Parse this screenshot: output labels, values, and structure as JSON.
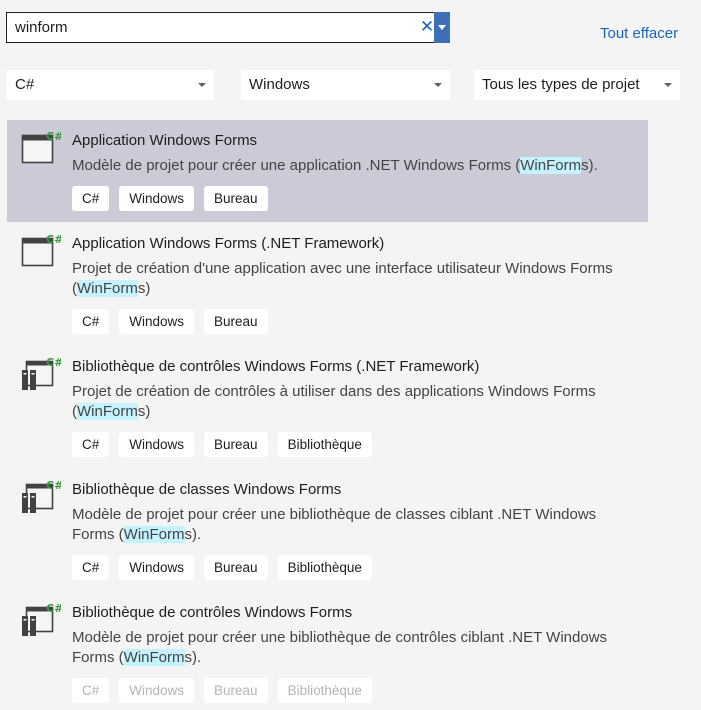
{
  "search": {
    "value": "winform",
    "clear_label": "Tout effacer"
  },
  "filters": {
    "language": "C#",
    "platform": "Windows",
    "project_type": "Tous les types de projet"
  },
  "results": [
    {
      "title": "Application Windows Forms",
      "desc_before": "Modèle de projet pour créer une application .NET Windows Forms (",
      "desc_highlight": "WinForm",
      "desc_after": "s).",
      "tags": [
        "C#",
        "Windows",
        "Bureau"
      ]
    },
    {
      "title": "Application Windows Forms (.NET Framework)",
      "desc_before": "Projet de création d'une application avec une interface utilisateur Windows Forms (",
      "desc_highlight": "WinForm",
      "desc_after": "s)",
      "tags": [
        "C#",
        "Windows",
        "Bureau"
      ]
    },
    {
      "title": "Bibliothèque de contrôles Windows Forms (.NET Framework)",
      "desc_before": "Projet de création de contrôles à utiliser dans des applications Windows Forms (",
      "desc_highlight": "WinForm",
      "desc_after": "s)",
      "tags": [
        "C#",
        "Windows",
        "Bureau",
        "Bibliothèque"
      ]
    },
    {
      "title": "Bibliothèque de classes Windows Forms",
      "desc_before": "Modèle de projet pour créer une bibliothèque de classes ciblant .NET Windows Forms (",
      "desc_highlight": "WinForm",
      "desc_after": "s).",
      "tags": [
        "C#",
        "Windows",
        "Bureau",
        "Bibliothèque"
      ]
    },
    {
      "title": "Bibliothèque de contrôles Windows Forms",
      "desc_before": "Modèle de projet pour créer une bibliothèque de contrôles ciblant .NET Windows Forms (",
      "desc_highlight": "WinForm",
      "desc_after": "s).",
      "tags": [
        "C#",
        "Windows",
        "Bureau",
        "Bibliothèque"
      ]
    }
  ],
  "colors": {
    "selected_bg": "#cacbd6",
    "link": "#1c64b8",
    "highlight": "#c5f2ff",
    "csharp_badge": "#389a3d"
  },
  "icons": {
    "app": "windows-form-app-icon",
    "library": "windows-form-library-icon"
  }
}
